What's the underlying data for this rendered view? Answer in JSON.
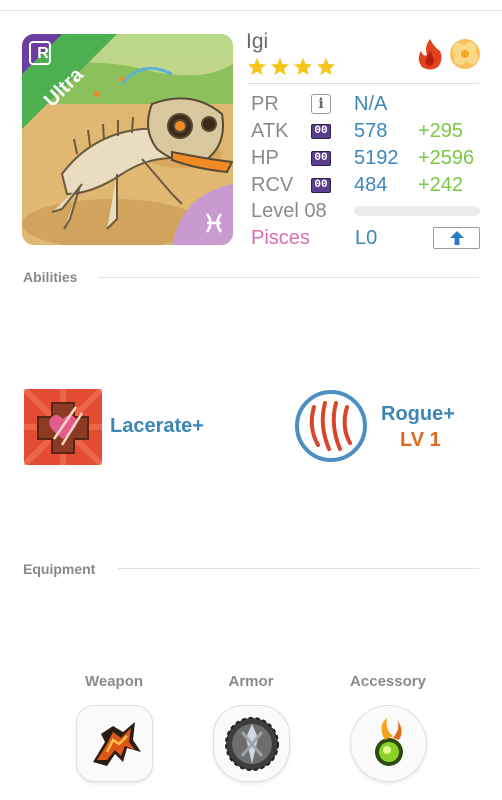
{
  "creature": {
    "name": "Igi",
    "rarity": "Ultra",
    "rarity_badge": "R",
    "stars": 4,
    "elements": [
      "fire-icon",
      "sand-icon"
    ],
    "zodiac": "Pisces"
  },
  "stats": {
    "pr": {
      "label": "PR",
      "value": "N/A"
    },
    "atk": {
      "label": "ATK",
      "badge": "00",
      "value": "578",
      "bonus": "+295"
    },
    "hp": {
      "label": "HP",
      "badge": "00",
      "value": "5192",
      "bonus": "+2596"
    },
    "rcv": {
      "label": "RCV",
      "badge": "00",
      "value": "484",
      "bonus": "+242"
    }
  },
  "level": {
    "label": "Level 08",
    "progress": 0
  },
  "bond": {
    "label": "L0"
  },
  "abilities": {
    "title": "Abilities",
    "items": [
      {
        "name": "Lacerate+"
      },
      {
        "name": "Rogue+",
        "level": "LV 1"
      }
    ]
  },
  "equipment": {
    "title": "Equipment",
    "slots": [
      {
        "label": "Weapon"
      },
      {
        "label": "Armor"
      },
      {
        "label": "Accessory"
      }
    ]
  },
  "colors": {
    "stat_value": "#3f86b8",
    "stat_bonus": "#7ac943",
    "zodiac": "#d66fb5",
    "ability_level": "#e06a1b",
    "rarity_banner": "#4caf50",
    "rarity_corner": "#6a3fa0"
  }
}
